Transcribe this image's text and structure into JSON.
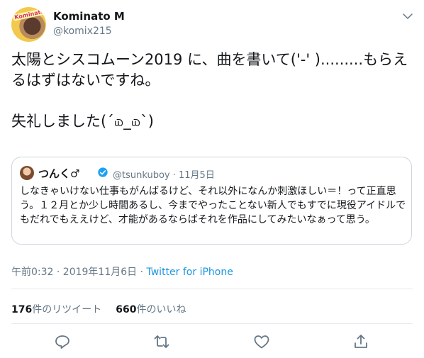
{
  "author": {
    "name": "Kominato M",
    "handle": "@komix215",
    "avatar_badge": "Kominato"
  },
  "tweet": {
    "text_line1": "太陽とシスコムーン2019 に、曲を書いて('-' ).........もらえるはずはないですね。",
    "text_line2": "失礼しました(´௰_௰`)"
  },
  "quote": {
    "name": "つんく♂",
    "meta": "@tsunkuboy · 11月5日",
    "text": "しなきゃいけない仕事もがんばるけど、それ以外になんか刺激ほしい＝！って正直思う。１２月とか少し時間あるし、今までやったことない新人でもすでに現役アイドルでもだれでもええけど、才能があるならばそれを作品にしてみたいなぁって思う。"
  },
  "timestamp": {
    "time": "午前0:32 · 2019年11月6日 · ",
    "source": "Twitter for iPhone"
  },
  "stats": {
    "retweets_count": "176",
    "retweets_label": "件のリツイート",
    "likes_count": "660",
    "likes_label": "件のいいね"
  },
  "icons": {
    "menu": "chevron-down-icon",
    "verified": "verified-badge-icon",
    "reply": "reply-icon",
    "retweet": "retweet-icon",
    "like": "heart-icon",
    "share": "share-icon"
  },
  "colors": {
    "link": "#1b95e0",
    "muted": "#657786",
    "icon": "#657786",
    "text": "#14171a"
  }
}
